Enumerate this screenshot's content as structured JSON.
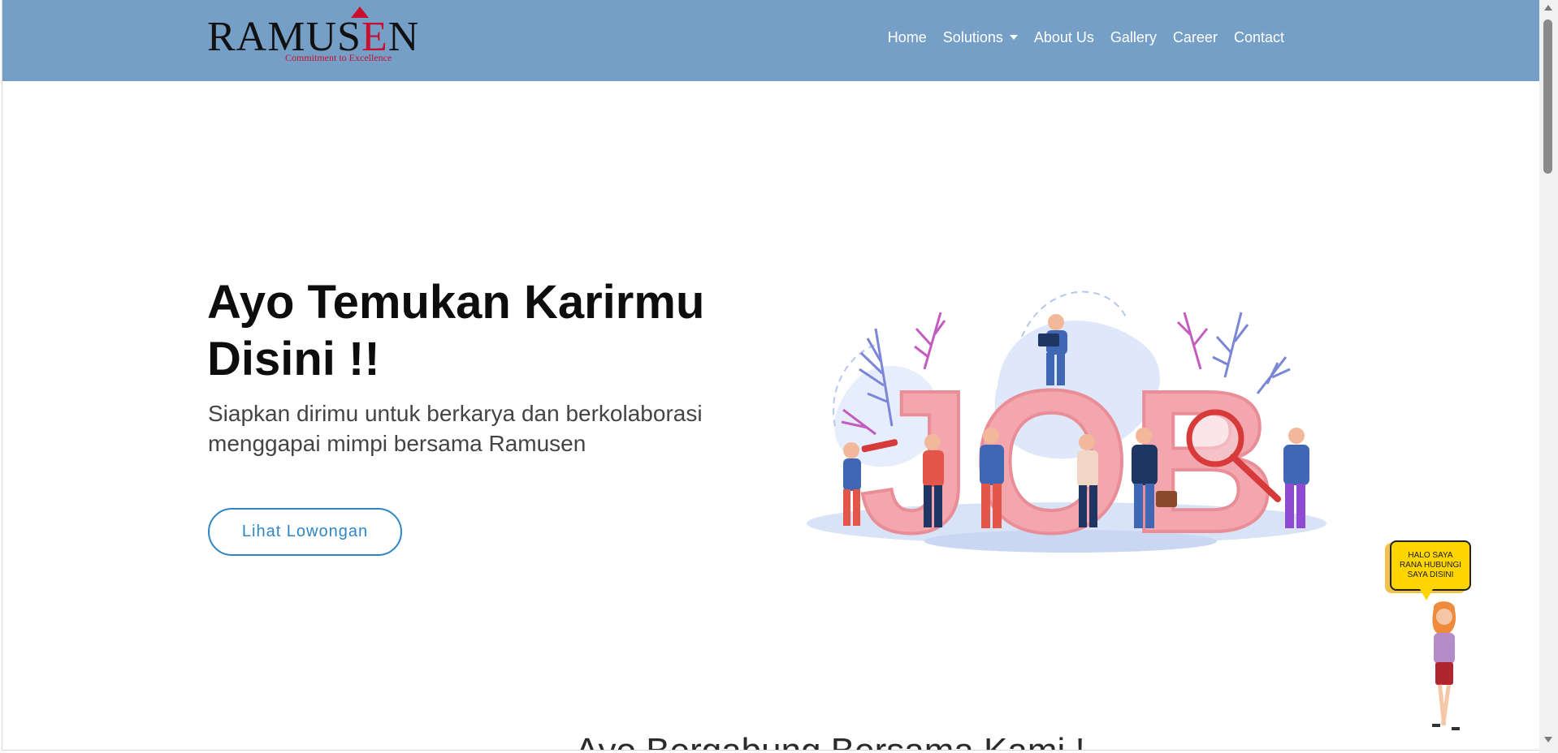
{
  "brand": {
    "logo_word_prefix": "RAMUS",
    "logo_word_e": "E",
    "logo_word_suffix": "N",
    "tagline": "Commitment to Excellence"
  },
  "nav": {
    "items": [
      {
        "label": "Home"
      },
      {
        "label": "Solutions"
      },
      {
        "label": "About Us"
      },
      {
        "label": "Gallery"
      },
      {
        "label": "Career"
      },
      {
        "label": "Contact"
      }
    ]
  },
  "hero": {
    "title": "Ayo Temukan Karirmu Disini !!",
    "subtitle": "Siapkan dirimu untuk berkarya dan berkolaborasi menggapai mimpi bersama Ramusen",
    "cta_label": "Lihat Lowongan",
    "illustration_text": "JOB"
  },
  "next_section": {
    "heading": "Ayo Bergabung Bersama Kami !"
  },
  "chat_widget": {
    "bubble_text": "HALO SAYA RANA HUBUNGI SAYA DISINI"
  },
  "colors": {
    "navbar": "#759fc6",
    "accent": "#2f86c5",
    "brand_red": "#c8102e",
    "job_letters": "#f5a9b0"
  }
}
